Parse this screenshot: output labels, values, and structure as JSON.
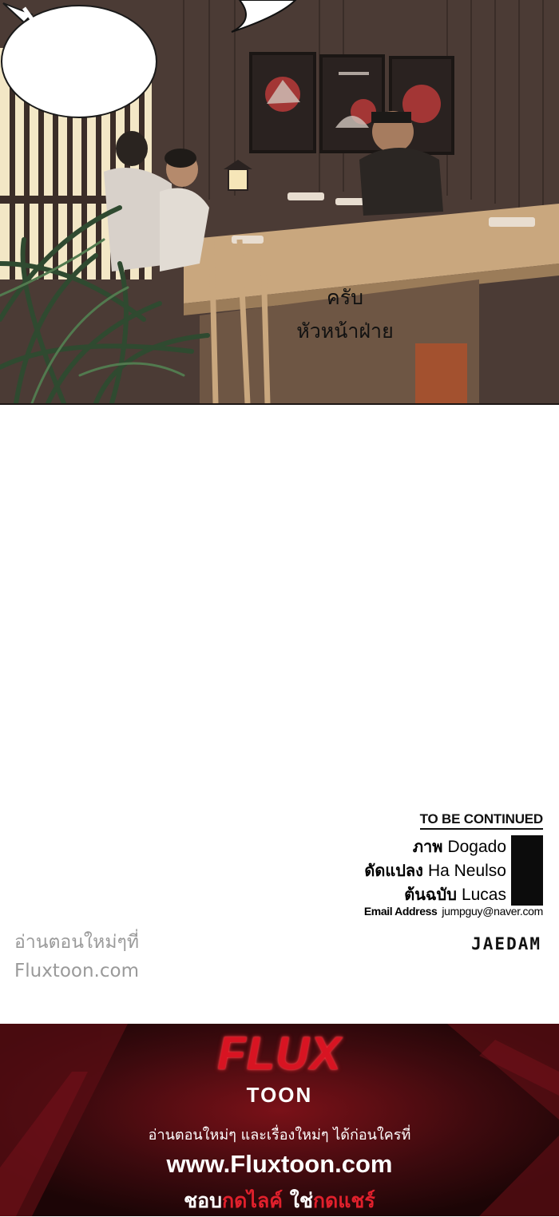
{
  "panel": {
    "speech_bubble": {
      "line1": "ครับ",
      "line2": "หัวหน้าฝ่าย"
    }
  },
  "credits": {
    "to_be_continued": "TO BE CONTINUED",
    "art_role": "ภาพ",
    "art_name": "Dogado",
    "adapt_role": "ดัดแปลง",
    "adapt_name": "Ha Neulso",
    "original_role": "ต้นฉบับ",
    "original_name": "Lucas",
    "email_label": "Email Address",
    "email_value": "jumpguy@naver.com",
    "publisher": "JAEDAM"
  },
  "watermark": {
    "line1": "อ่านตอนใหม่ๆที่",
    "line2": "Fluxtoon.com"
  },
  "banner": {
    "logo_top": "FLUX",
    "logo_bottom": "TOON",
    "tagline": "อ่านตอนใหม่ๆ และเรื่องใหม่ๆ ได้ก่อนใครที่",
    "site": "www.Fluxtoon.com",
    "cta_1": "ชอบ",
    "cta_2": "กดไลค์",
    "cta_3": " ใช่",
    "cta_4": "กดแชร์",
    "accent_color": "#e0202c"
  }
}
